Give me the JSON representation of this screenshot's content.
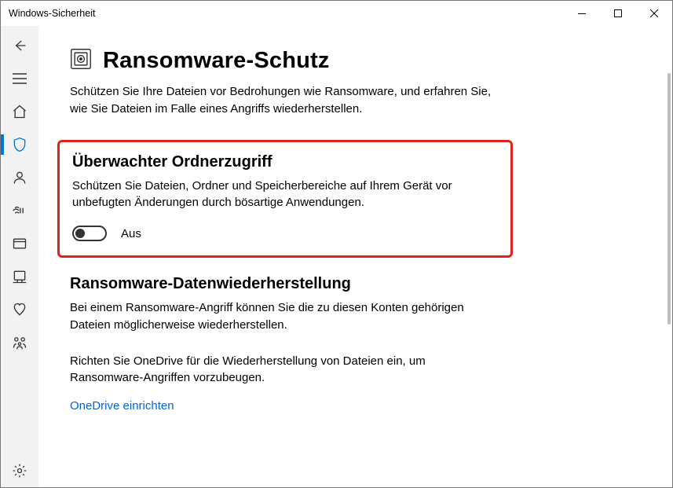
{
  "window": {
    "title": "Windows-Sicherheit"
  },
  "page": {
    "title": "Ransomware-Schutz",
    "subtitle": "Schützen Sie Ihre Dateien vor Bedrohungen wie Ransomware, und erfahren Sie, wie Sie Dateien im Falle eines Angriffs wiederherstellen."
  },
  "section_cfa": {
    "heading": "Überwachter Ordnerzugriff",
    "desc": "Schützen Sie Dateien, Ordner und Speicherbereiche auf Ihrem Gerät vor unbefugten Änderungen durch bösartige Anwendungen.",
    "toggle_label": "Aus"
  },
  "section_recovery": {
    "heading": "Ransomware-Datenwiederherstellung",
    "desc": "Bei einem Ransomware-Angriff können Sie die zu diesen Konten gehörigen Dateien möglicherweise wiederherstellen."
  },
  "onedrive": {
    "prompt": "Richten Sie OneDrive für die Wiederherstellung von Dateien ein, um Ransomware-Angriffen vorzubeugen.",
    "link": "OneDrive einrichten"
  }
}
